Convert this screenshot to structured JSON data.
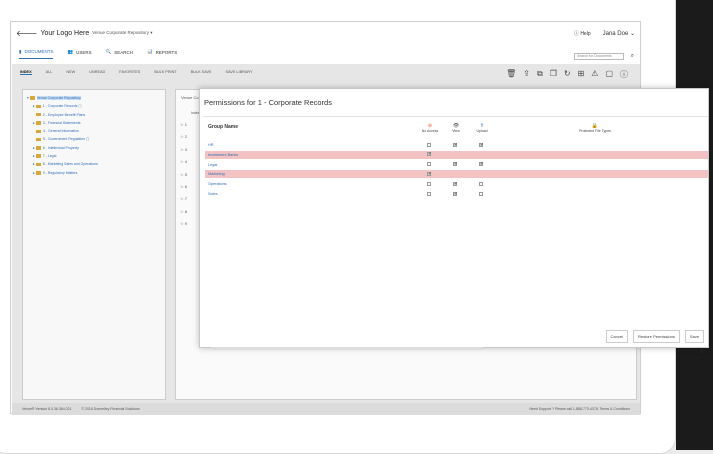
{
  "header": {
    "logo_text": "Your Logo Here",
    "repository": "Venue Corporate Repository ▾",
    "help": "Help",
    "user": "Jana Doe ⌄"
  },
  "nav": {
    "documents": "DOCUMENTS",
    "users": "USERS",
    "search": "SEARCH",
    "reports": "REPORTS",
    "search_placeholder": "Search for Documents"
  },
  "tabs": [
    "INDEX",
    "ALL",
    "NEW",
    "UNREAD",
    "FAVORITES",
    "BULK PRINT",
    "BULK SAVE",
    "SAVE LIBRARY"
  ],
  "tree": [
    "Venue Corporate Repository",
    "1 - Corporate Records",
    "2 - Employee Benefit Plans",
    "3 - Financial Statements",
    "4 - General Information",
    "5 - Government Regulation",
    "6 - Intellectual Property",
    "7 - Legal",
    "8 - Marketing Sales and Operations",
    "9 - Regulatory Matters"
  ],
  "mid": {
    "title": "Venue Co",
    "column": "Index",
    "numbers": [
      "1",
      "2",
      "3",
      "4",
      "5",
      "6",
      "7",
      "8",
      "9"
    ]
  },
  "footer": {
    "left": "Venue® Version 8.0.36.364.021",
    "copy": "© 2016 Donnelley Financial Solutions",
    "right": "Need Support ? Please call 1-888-773-4378. Terms & Conditions"
  },
  "modal": {
    "title": "Permissions for  1 - Corporate Records",
    "group_header": "Group Name",
    "columns": [
      "No Access",
      "View",
      "Upload",
      "Protected File Types"
    ],
    "rows": [
      {
        "name": "HR",
        "highlight": false,
        "checks": [
          false,
          true,
          true
        ]
      },
      {
        "name": "Investment Banks",
        "highlight": true,
        "checks": [
          true,
          false,
          false
        ]
      },
      {
        "name": "Legal",
        "highlight": false,
        "checks": [
          false,
          true,
          true
        ]
      },
      {
        "name": "Marketing",
        "highlight": true,
        "checks": [
          true,
          false,
          false
        ]
      },
      {
        "name": "Operations",
        "highlight": false,
        "checks": [
          false,
          true,
          false
        ]
      },
      {
        "name": "Sales",
        "highlight": false,
        "checks": [
          false,
          true,
          false
        ]
      }
    ],
    "buttons": {
      "cancel": "Cancel",
      "restore": "Restore Permissions",
      "save": "Save"
    }
  }
}
